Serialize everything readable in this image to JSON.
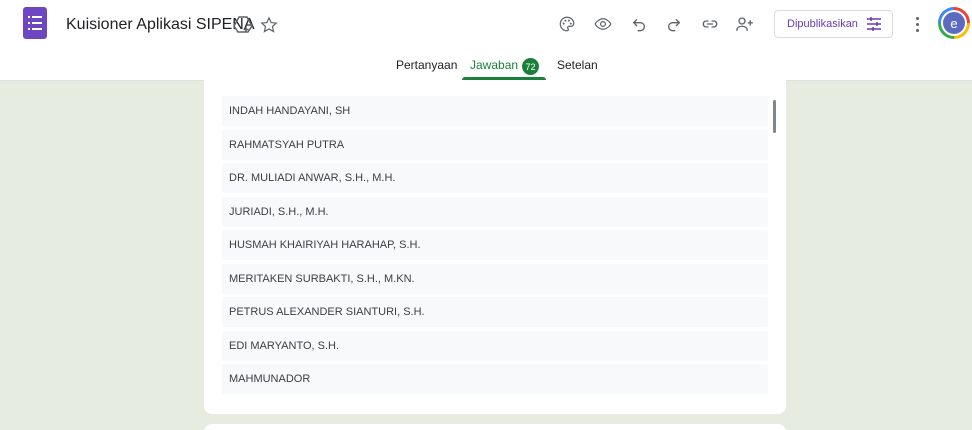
{
  "app": {
    "title": "Kuisioner Aplikasi SIPENA",
    "publish_label": "Dipublikasikan",
    "avatar_letter": "e",
    "accent_color": "#673ab7",
    "active_tab_color": "#188038"
  },
  "tabs": {
    "questions": "Pertanyaan",
    "responses": "Jawaban",
    "response_count": "72",
    "settings": "Setelan"
  },
  "icons": [
    "forms-logo-icon",
    "add-to-drive-icon",
    "star-icon",
    "palette-icon",
    "preview-eye-icon",
    "undo-icon",
    "redo-icon",
    "link-icon",
    "add-collaborator-icon",
    "tune-icon",
    "more-vert-icon"
  ],
  "responses": [
    "INDAH HANDAYANI, SH",
    "RAHMATSYAH PUTRA",
    "DR. MULIADI ANWAR, S.H., M.H.",
    "JURIADI, S.H., M.H.",
    "HUSMAH KHAIRIYAH HARAHAP, S.H.",
    "MERITAKEN SURBAKTI, S.H., M.KN.",
    "PETRUS ALEXANDER SIANTURI, S.H.",
    "EDI MARYANTO, S.H.",
    "MAHMUNADOR"
  ]
}
